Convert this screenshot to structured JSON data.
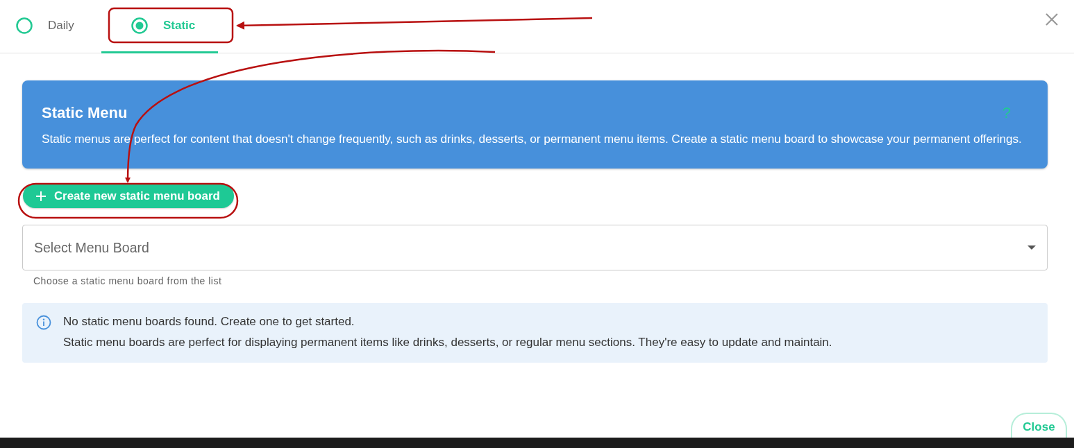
{
  "tabs": [
    {
      "label": "Daily",
      "selected": false
    },
    {
      "label": "Static",
      "selected": true
    }
  ],
  "banner": {
    "title": "Static Menu",
    "description": "Static menus are perfect for content that doesn't change frequently, such as drinks, desserts, or permanent menu items. Create a static menu board to showcase your permanent offerings.",
    "help": "?"
  },
  "create_button": {
    "label": "Create new static menu board"
  },
  "select": {
    "placeholder": "Select Menu Board",
    "hint": "Choose a static menu board from the list"
  },
  "info": {
    "lines": [
      "No static menu boards found. Create one to get started.",
      "Static menu boards are perfect for displaying permanent items like drinks, desserts, or regular menu sections. They're easy to update and maintain."
    ]
  },
  "close_button": {
    "label": "Close"
  }
}
